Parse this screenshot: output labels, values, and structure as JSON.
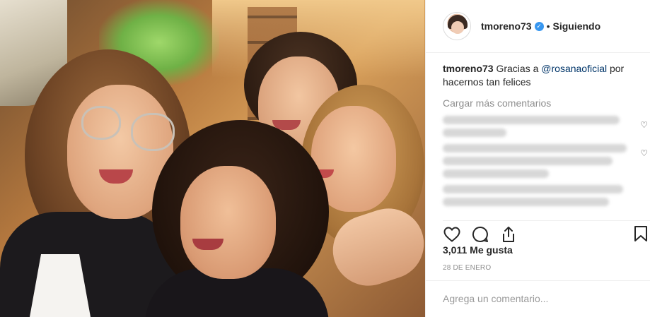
{
  "post": {
    "username": "tmoreno73",
    "follow_status": "Siguiendo",
    "separator": "•",
    "caption": {
      "username": "tmoreno73",
      "text_before": "Gracias a ",
      "mention": "@rosanaoficial",
      "text_after": " por hacernos tan felices"
    },
    "load_more": "Cargar más comentarios",
    "likes": "3,011 Me gusta",
    "date": "28 DE ENERO",
    "comment_placeholder": "Agrega un comentario..."
  },
  "icons": {
    "verified": "verified-badge-icon",
    "like": "heart-icon",
    "comment": "comment-icon",
    "share": "share-icon",
    "save": "bookmark-icon"
  },
  "colors": {
    "accent": "#3897f0",
    "mention": "#003569",
    "muted": "#8e8e8e"
  }
}
